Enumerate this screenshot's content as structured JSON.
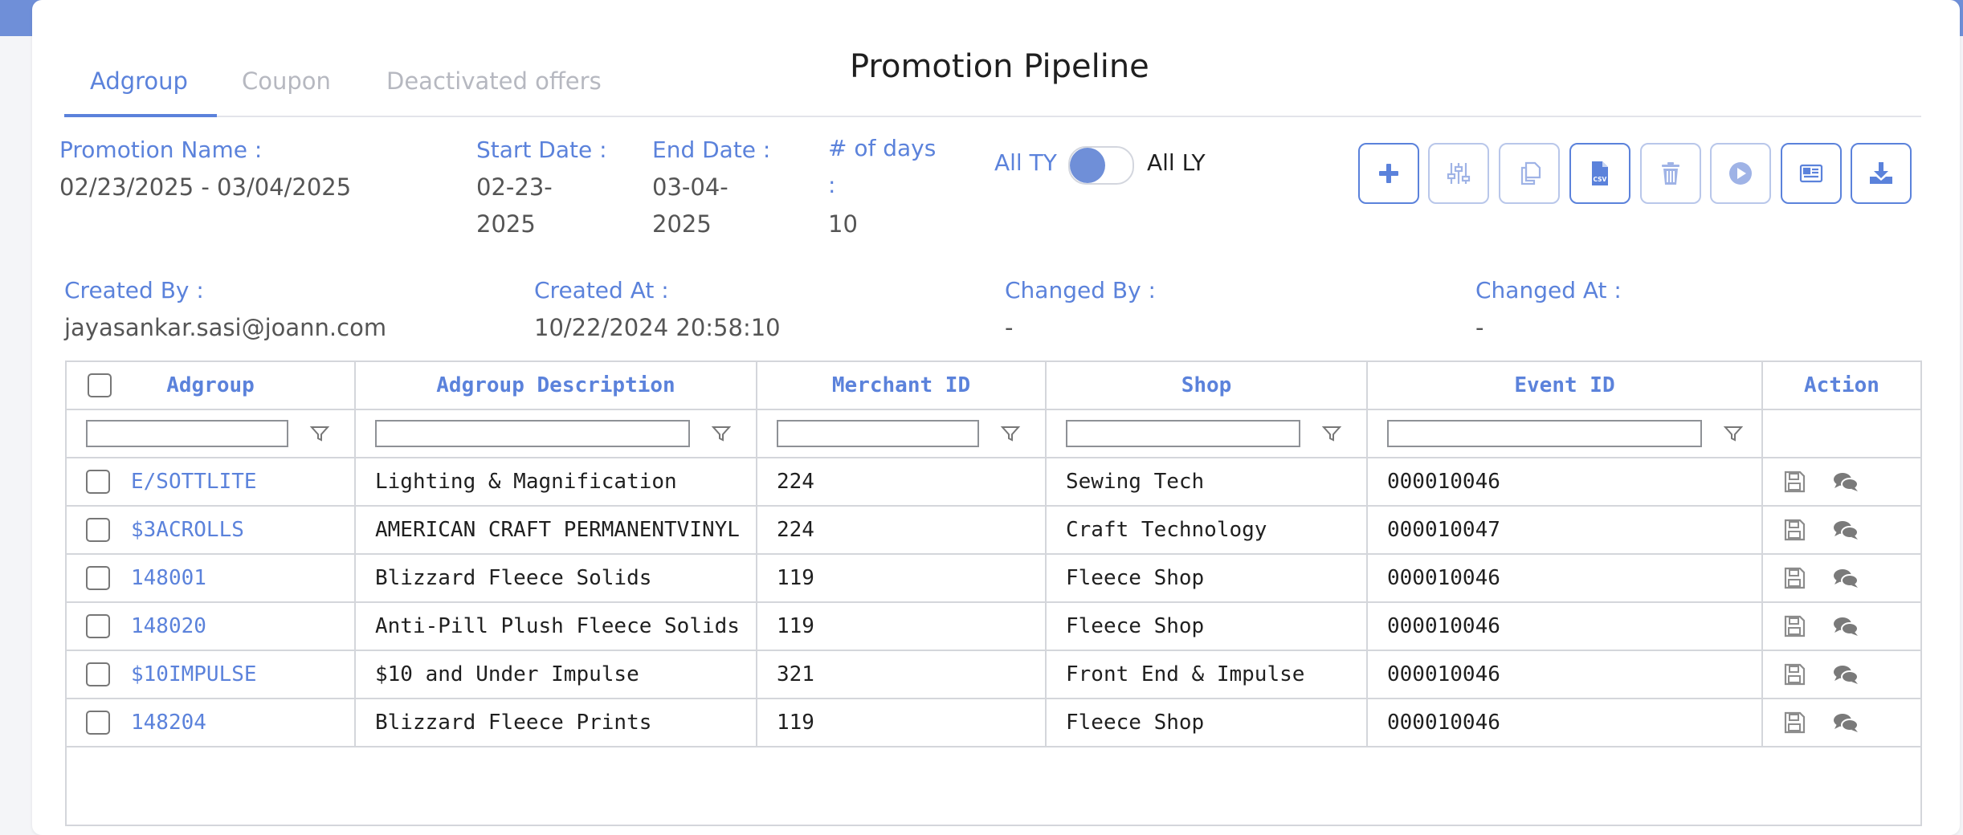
{
  "page": {
    "title": "Promotion Pipeline"
  },
  "tabs": [
    {
      "label": "Adgroup",
      "active": true
    },
    {
      "label": "Coupon",
      "active": false
    },
    {
      "label": "Deactivated offers",
      "active": false
    }
  ],
  "info": {
    "promotion_name_label": "Promotion Name :",
    "promotion_name_value": "02/23/2025 - 03/04/2025",
    "start_date_label": "Start Date :",
    "start_date_value": "02-23-2025",
    "end_date_label": "End Date :",
    "end_date_value": "03-04-2025",
    "days_label": "# of days :",
    "days_value": "10",
    "created_by_label": "Created By :",
    "created_by_value": "jayasankar.sasi@joann.com",
    "created_at_label": "Created At :",
    "created_at_value": "10/22/2024 20:58:10",
    "changed_by_label": "Changed By :",
    "changed_by_value": "-",
    "changed_at_label": "Changed At :",
    "changed_at_value": "-"
  },
  "toggle": {
    "left_label": "All TY",
    "right_label": "All LY",
    "selected": "All TY"
  },
  "toolbar": {
    "buttons": [
      {
        "icon": "plus-icon",
        "enabled": true
      },
      {
        "icon": "sliders-icon",
        "enabled": false
      },
      {
        "icon": "copy-icon",
        "enabled": false
      },
      {
        "icon": "csv-file-icon",
        "enabled": true
      },
      {
        "icon": "trash-icon",
        "enabled": false
      },
      {
        "icon": "play-icon",
        "enabled": false
      },
      {
        "icon": "newspaper-icon",
        "enabled": true
      },
      {
        "icon": "download-icon",
        "enabled": true
      }
    ]
  },
  "table": {
    "columns": [
      "Adgroup",
      "Adgroup Description",
      "Merchant ID",
      "Shop",
      "Event ID",
      "Action"
    ],
    "rows": [
      {
        "adgroup": "E/SOTTLITE",
        "description": "Lighting & Magnification",
        "merchant_id": "224",
        "shop": "Sewing Tech",
        "event_id": "000010046"
      },
      {
        "adgroup": "$3ACROLLS",
        "description": "AMERICAN CRAFT PERMANENTVINYL",
        "merchant_id": "224",
        "shop": "Craft Technology",
        "event_id": "000010047"
      },
      {
        "adgroup": "148001",
        "description": "Blizzard Fleece Solids",
        "merchant_id": "119",
        "shop": "Fleece Shop",
        "event_id": "000010046"
      },
      {
        "adgroup": "148020",
        "description": "Anti-Pill Plush Fleece Solids",
        "merchant_id": "119",
        "shop": "Fleece Shop",
        "event_id": "000010046"
      },
      {
        "adgroup": "$10IMPULSE",
        "description": "$10 and Under Impulse",
        "merchant_id": "321",
        "shop": "Front End & Impulse",
        "event_id": "000010046"
      },
      {
        "adgroup": "148204",
        "description": "Blizzard Fleece Prints",
        "merchant_id": "119",
        "shop": "Fleece Shop",
        "event_id": "000010046"
      }
    ],
    "row_actions": [
      "save-icon",
      "comments-icon"
    ]
  },
  "colors": {
    "accent": "#5b82db",
    "topbar": "#6f8fd8",
    "disabled_border": "#b9c7ea"
  }
}
